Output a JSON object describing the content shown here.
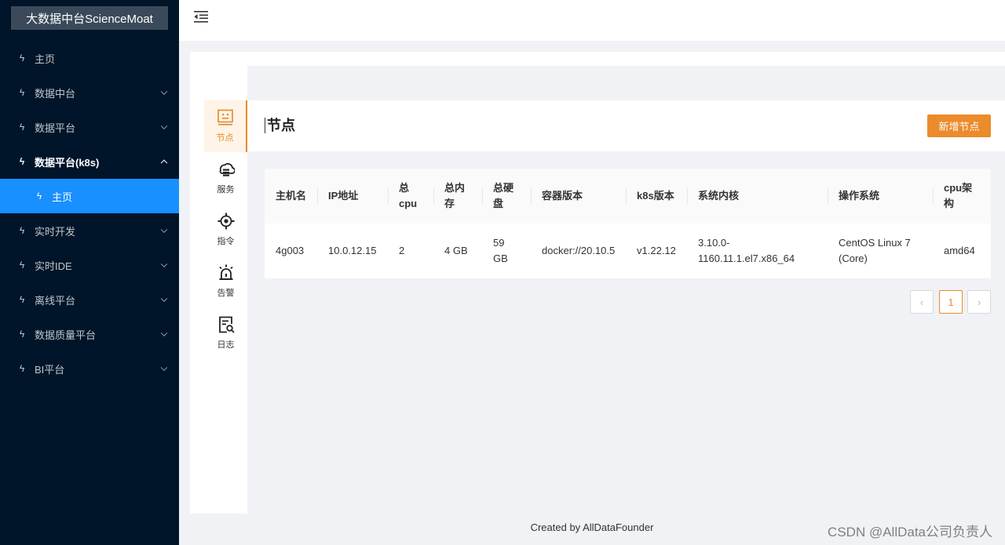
{
  "app": {
    "title": "大数据中台ScienceMoat"
  },
  "sidebar": {
    "items": [
      {
        "label": "主页",
        "icon": "lightning-icon"
      },
      {
        "label": "数据中台",
        "icon": "lightning-icon"
      },
      {
        "label": "数据平台",
        "icon": "lightning-icon"
      },
      {
        "label": "数据平台(k8s)",
        "icon": "lightning-icon"
      },
      {
        "label": "主页",
        "icon": "lightning-icon"
      },
      {
        "label": "实时开发",
        "icon": "lightning-icon"
      },
      {
        "label": "实时IDE",
        "icon": "lightning-icon"
      },
      {
        "label": "离线平台",
        "icon": "lightning-icon"
      },
      {
        "label": "数据质量平台",
        "icon": "lightning-icon"
      },
      {
        "label": "BI平台",
        "icon": "lightning-icon"
      }
    ]
  },
  "vtabs": [
    {
      "label": "节点",
      "icon": "node-icon"
    },
    {
      "label": "服务",
      "icon": "cloud-service-icon"
    },
    {
      "label": "指令",
      "icon": "target-icon"
    },
    {
      "label": "告警",
      "icon": "alarm-icon"
    },
    {
      "label": "日志",
      "icon": "log-icon"
    }
  ],
  "page": {
    "title": "节点",
    "add_button": "新增节点"
  },
  "table": {
    "columns": [
      "主机名",
      "IP地址",
      "总cpu",
      "总内存",
      "总硬盘",
      "容器版本",
      "k8s版本",
      "系统内核",
      "操作系统",
      "cpu架构"
    ],
    "rows": [
      [
        "4g003",
        "10.0.12.15",
        "2",
        "4 GB",
        "59 GB",
        "docker://20.10.5",
        "v1.22.12",
        "3.10.0-1160.11.1.el7.x86_64",
        "CentOS Linux 7 (Core)",
        "amd64"
      ]
    ]
  },
  "pagination": {
    "prev": "‹",
    "current": "1",
    "next": "›"
  },
  "footer": {
    "text": "Created by AllDataFounder"
  },
  "watermark": "CSDN @AllData公司负责人",
  "colors": {
    "accent": "#eb8b2b",
    "sidebar_bg": "#001529",
    "selected": "#1890ff"
  }
}
